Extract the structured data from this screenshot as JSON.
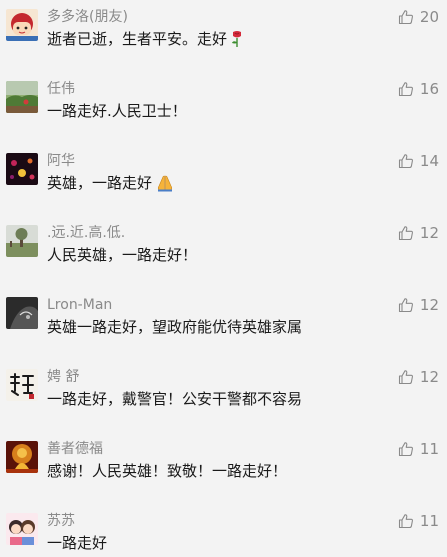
{
  "colors": {
    "background": "#f3f3f3",
    "name": "#8a8a8a",
    "text": "#1a1a1a",
    "like": "#8a8a8a"
  },
  "comments": [
    {
      "name": "多多洛(朋友)",
      "text": "逝者已逝，生者平安。走好",
      "emoji": "rose-emoji",
      "likes": "20",
      "avatar": "cartoon-girl-avatar"
    },
    {
      "name": "任伟",
      "text": "一路走好.人民卫士！",
      "emoji": "",
      "likes": "16",
      "avatar": "landscape-avatar"
    },
    {
      "name": "阿华",
      "text": "英雄，一路走好",
      "emoji": "folded-hands-emoji",
      "likes": "14",
      "avatar": "night-scene-avatar"
    },
    {
      "name": ".远.近.高.低.",
      "text": "人民英雄，一路走好！",
      "emoji": "",
      "likes": "12",
      "avatar": "tree-landscape-avatar"
    },
    {
      "name": "Lron-Man",
      "text": "英雄一路走好，望政府能优待英雄家属",
      "emoji": "",
      "likes": "12",
      "avatar": "dark-portrait-avatar"
    },
    {
      "name": "娉 舒",
      "text": "一路走好，戴警官！公安干警都不容易",
      "emoji": "",
      "likes": "12",
      "avatar": "calligraphy-avatar"
    },
    {
      "name": "善者德福",
      "text": "感谢！人民英雄！致敬！一路走好！",
      "emoji": "",
      "likes": "11",
      "avatar": "buddha-avatar"
    },
    {
      "name": "苏苏",
      "text": "一路走好",
      "emoji": "",
      "likes": "11",
      "avatar": "cartoon-couple-avatar"
    }
  ]
}
